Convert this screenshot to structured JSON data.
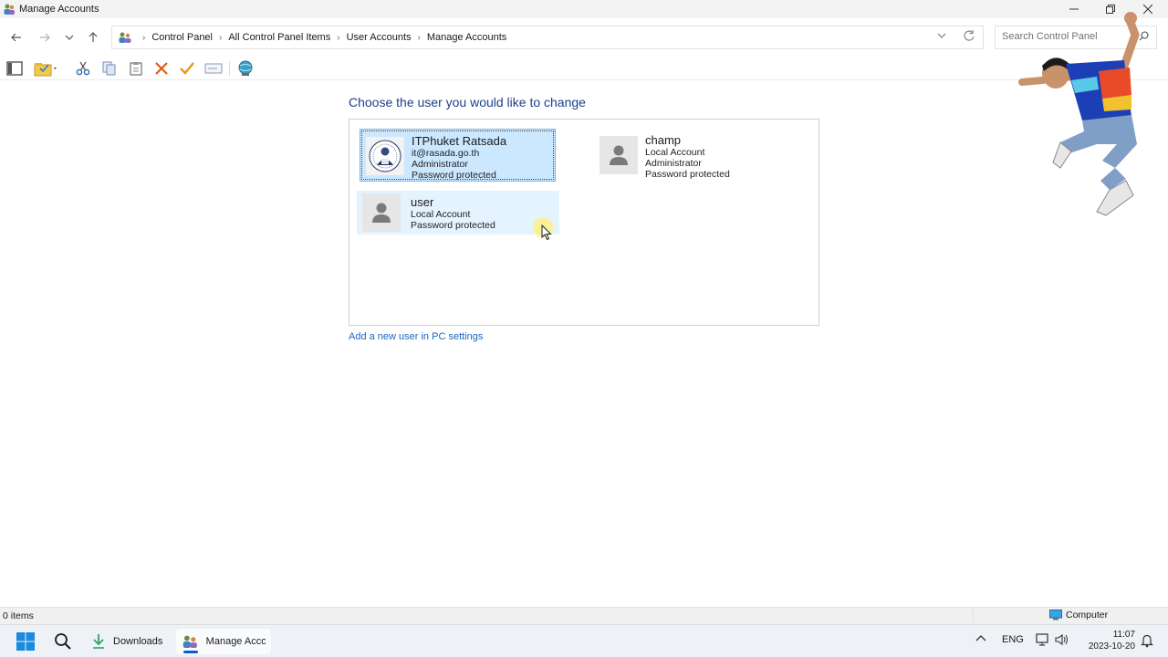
{
  "window": {
    "title": "Manage Accounts",
    "minimize_icon": "minimize-icon",
    "restore_icon": "restore-icon",
    "close_icon": "close-icon"
  },
  "address": {
    "breadcrumbs": [
      "Control Panel",
      "All Control Panel Items",
      "User Accounts",
      "Manage Accounts"
    ]
  },
  "search": {
    "placeholder": "Search Control Panel"
  },
  "toolbar": {
    "icons": [
      "layout-pane-icon",
      "properties-icon",
      "cut-icon",
      "copy-icon",
      "paste-icon",
      "delete-icon",
      "check-icon",
      "rename-icon",
      "network-icon"
    ]
  },
  "main": {
    "heading": "Choose the user you would like to change",
    "accounts": [
      {
        "name": "ITPhuket Ratsada",
        "lines": [
          "it@rasada.go.th",
          "Administrator",
          "Password protected"
        ],
        "state": "selected"
      },
      {
        "name": "champ",
        "lines": [
          "Local Account",
          "Administrator",
          "Password protected"
        ],
        "state": "normal"
      },
      {
        "name": "user",
        "lines": [
          "Local Account",
          "Password protected"
        ],
        "state": "hover"
      }
    ],
    "add_user_link": "Add a new user in PC settings"
  },
  "statusbar": {
    "items_count": "0 items",
    "location": "Computer"
  },
  "taskbar": {
    "apps": [
      {
        "label": "Downloads",
        "icon": "download-icon"
      },
      {
        "label": "Manage Accou",
        "icon": "users-icon"
      }
    ],
    "language": "ENG",
    "time": "11:07",
    "date": "2023-10-20"
  },
  "colors": {
    "accent": "#0a5fc9",
    "heading": "#1e3f8a",
    "link": "#1a66c0",
    "selected_bg": "#cce8ff",
    "hover_bg": "#e5f3ff"
  }
}
